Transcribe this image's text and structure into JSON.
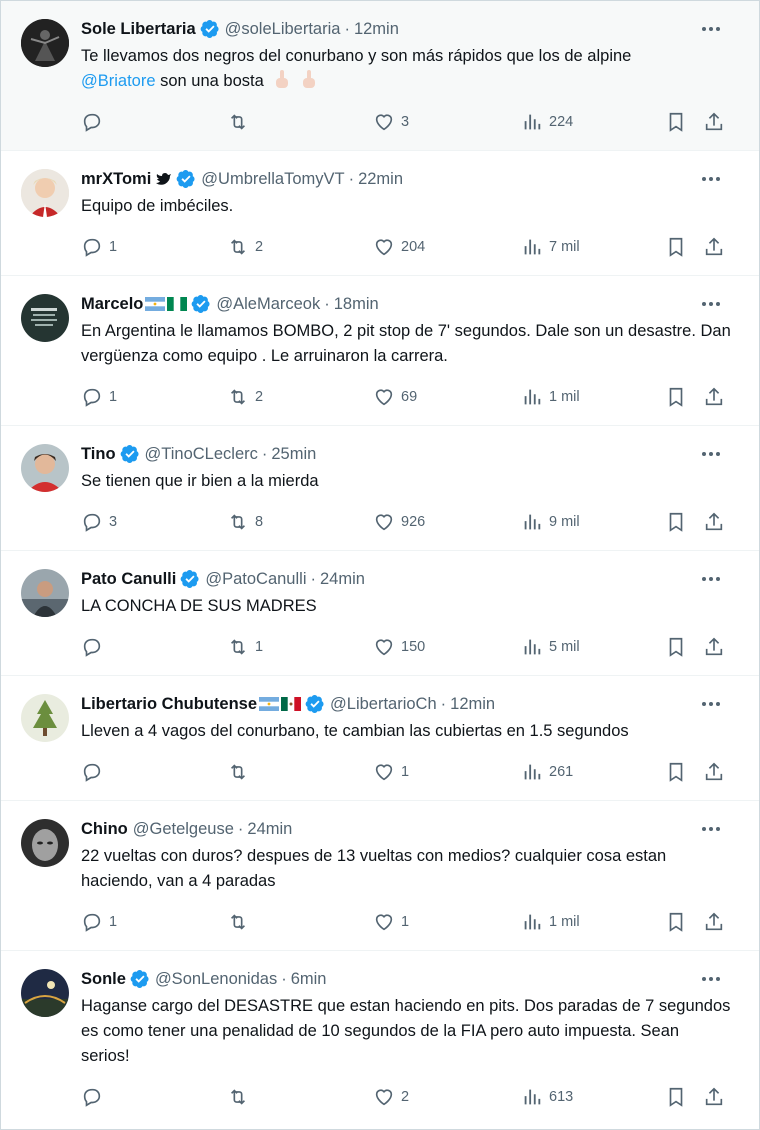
{
  "tweets": [
    {
      "name": "Sole Libertaria",
      "verified": true,
      "handle": "@soleLibertaria",
      "time": "12min",
      "text": "Te llevamos dos negros del conurbano y son más rápidos que los de alpine",
      "mention": "@Briatore",
      "text2": "son una bosta",
      "replies": "",
      "retweets": "",
      "likes": "3",
      "views": "224",
      "highlighted": true
    },
    {
      "name": "mrXTomi",
      "verified": true,
      "handle": "@UmbrellaTomyVT",
      "time": "22min",
      "text": "Equipo de imbéciles.",
      "replies": "1",
      "retweets": "2",
      "likes": "204",
      "views": "7 mil"
    },
    {
      "name": "Marcelo",
      "verified": true,
      "handle": "@AleMarceok",
      "time": "18min",
      "text": "En Argentina le llamamos BOMBO, 2 pit stop de 7' segundos. Dale son un desastre. Dan vergüenza como equipo . Le arruinaron la carrera.",
      "replies": "1",
      "retweets": "2",
      "likes": "69",
      "views": "1 mil"
    },
    {
      "name": "Tino",
      "verified": true,
      "handle": "@TinoCLeclerc",
      "time": "25min",
      "text": "Se tienen que ir bien a la mierda",
      "replies": "3",
      "retweets": "8",
      "likes": "926",
      "views": "9 mil"
    },
    {
      "name": "Pato Canulli",
      "verified": true,
      "handle": "@PatoCanulli",
      "time": "24min",
      "text": "LA CONCHA DE SUS MADRES",
      "replies": "",
      "retweets": "1",
      "likes": "150",
      "views": "5 mil"
    },
    {
      "name": "Libertario Chubutense",
      "verified": true,
      "handle": "@LibertarioCh",
      "time": "12min",
      "text": "Lleven a 4 vagos del conurbano, te cambian las cubiertas en 1.5 segundos",
      "replies": "",
      "retweets": "",
      "likes": "1",
      "views": "261"
    },
    {
      "name": "Chino",
      "verified": false,
      "handle": "@Getelgeuse",
      "time": "24min",
      "text": "22 vueltas con duros? despues de 13 vueltas con medios? cualquier cosa estan haciendo, van a 4 paradas",
      "replies": "1",
      "retweets": "",
      "likes": "1",
      "views": "1 mil"
    },
    {
      "name": "Sonle",
      "verified": true,
      "handle": "@SonLenonidas",
      "time": "6min",
      "text": "Haganse cargo del DESASTRE que estan haciendo en pits. Dos paradas de 7 segundos es como tener una penalidad de 10 segundos de la FIA pero auto impuesta. Sean serios!",
      "replies": "",
      "retweets": "",
      "likes": "2",
      "views": "613"
    }
  ],
  "separator": "·",
  "icons": {
    "more": "more-icon",
    "reply": "reply-icon",
    "retweet": "retweet-icon",
    "like": "heart-icon",
    "views": "views-icon",
    "bookmark": "bookmark-icon",
    "share": "share-icon",
    "verified": "verified-badge-icon"
  },
  "colors": {
    "link": "#1d9bf0",
    "muted": "#536471",
    "verified": "#1d9bf0",
    "text": "#0f1419"
  }
}
